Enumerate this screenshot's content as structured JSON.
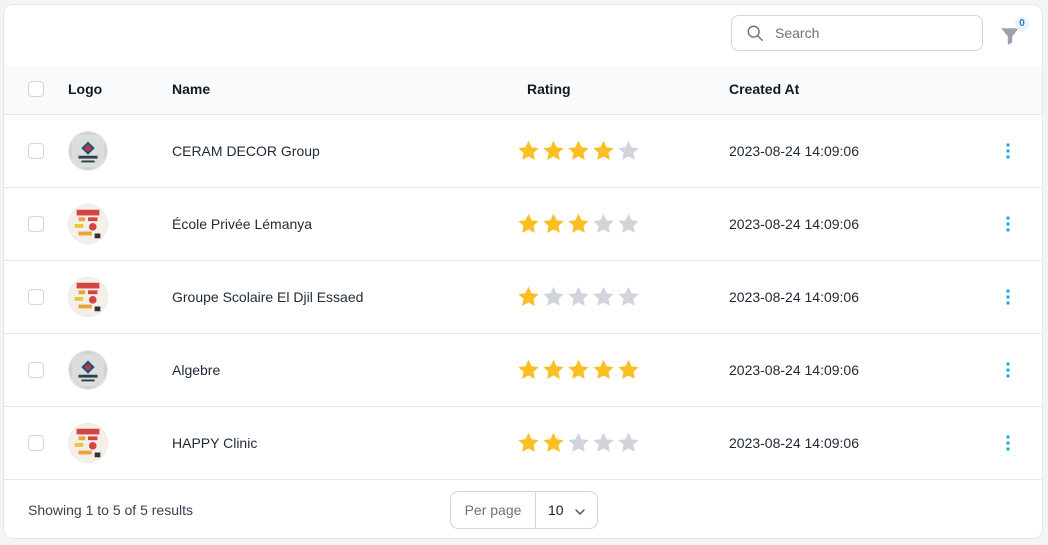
{
  "search": {
    "placeholder": "Search"
  },
  "filter": {
    "badge": "0"
  },
  "columns": {
    "logo": "Logo",
    "name": "Name",
    "rating": "Rating",
    "created_at": "Created At"
  },
  "rows": [
    {
      "name": "CERAM DECOR Group",
      "rating": 4,
      "created_at": "2023-08-24 14:09:06",
      "logo_icon": "ceram-decor-logo-icon"
    },
    {
      "name": "École Privée Lémanya",
      "rating": 3,
      "created_at": "2023-08-24 14:09:06",
      "logo_icon": "school-logo-icon"
    },
    {
      "name": "Groupe Scolaire El Djil Essaed",
      "rating": 1,
      "created_at": "2023-08-24 14:09:06",
      "logo_icon": "school-logo-icon"
    },
    {
      "name": "Algebre",
      "rating": 5,
      "created_at": "2023-08-24 14:09:06",
      "logo_icon": "ceram-decor-logo-icon"
    },
    {
      "name": "HAPPY Clinic",
      "rating": 2,
      "created_at": "2023-08-24 14:09:06",
      "logo_icon": "school-logo-icon"
    }
  ],
  "rating_max": 5,
  "footer": {
    "showing": "Showing 1 to 5 of 5 results",
    "per_page_label": "Per page",
    "per_page_value": "10"
  },
  "colors": {
    "star_filled": "#fbbf24",
    "star_empty": "#d1d5db",
    "kebab": "#0ea5e9"
  }
}
